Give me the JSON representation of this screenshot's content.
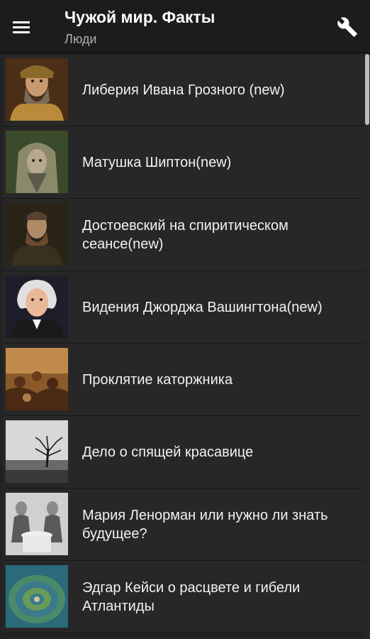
{
  "header": {
    "title": "Чужой мир. Факты",
    "subtitle": "Люди",
    "menu_icon": "hamburger-menu-icon",
    "settings_icon": "wrench-icon"
  },
  "list": {
    "items": [
      {
        "label": "Либерия Ивана Грозного (new)",
        "thumbnail": "portrait of Ivan the Terrible"
      },
      {
        "label": "Матушка Шиптон(new)",
        "thumbnail": "old woman with hood"
      },
      {
        "label": "Достоевский на спиритическом сеансе(new)",
        "thumbnail": "portrait of Dostoevsky"
      },
      {
        "label": "Видения Джорджа Вашингтона(new)",
        "thumbnail": "portrait of George Washington"
      },
      {
        "label": "Проклятие каторжника",
        "thumbnail": "painting of a crowd"
      },
      {
        "label": "Дело о спящей красавице",
        "thumbnail": "bare tree in fog"
      },
      {
        "label": "Мария Ленорман или нужно ли знать будущее?",
        "thumbnail": "engraving of women at a table"
      },
      {
        "label": "Эдгар Кейси о расцвете и гибели Атлантиды",
        "thumbnail": "map of Atlantis"
      }
    ]
  },
  "colors": {
    "background": "#222222",
    "appbar": "#1c1c1c",
    "row": "#272727",
    "text": "#f2f2f2",
    "subtitle": "#b0b0b0"
  }
}
